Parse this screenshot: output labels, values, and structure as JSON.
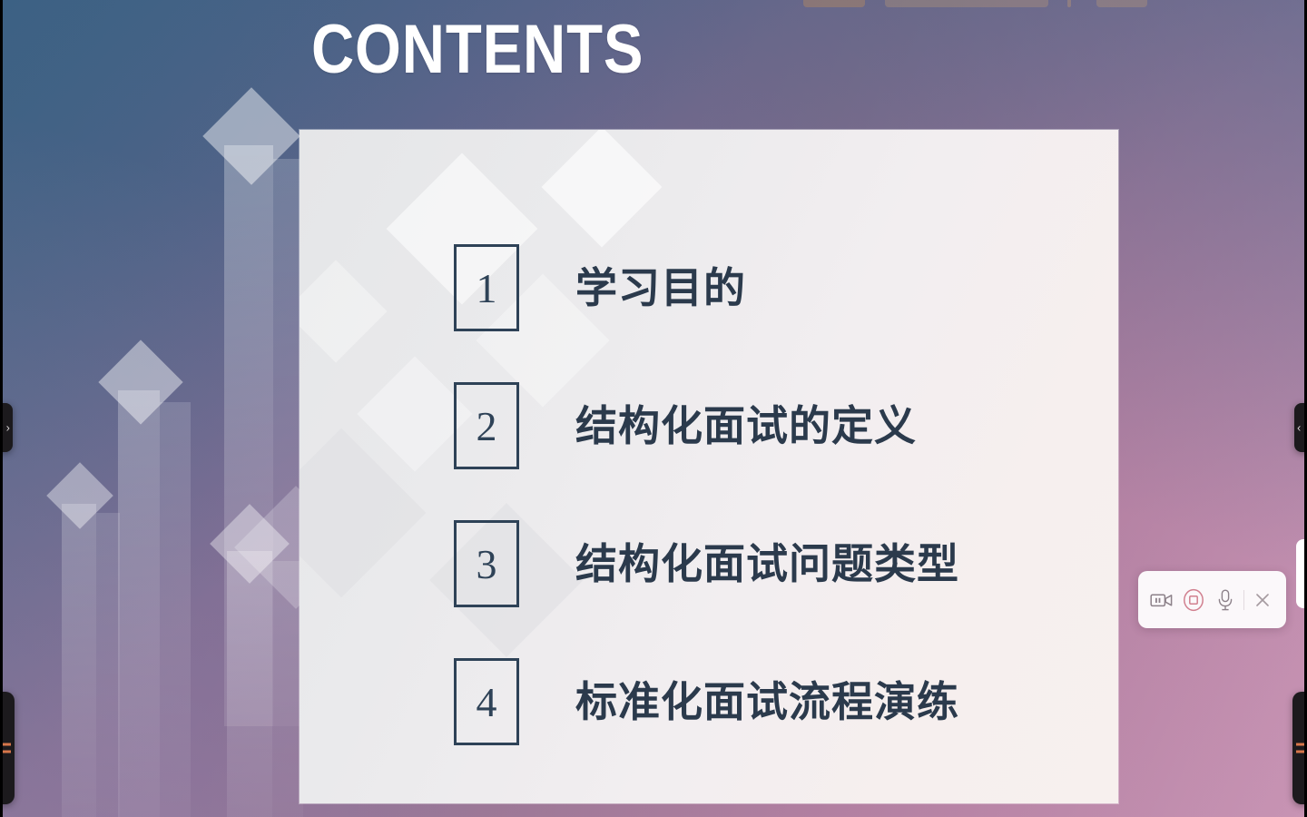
{
  "slide": {
    "title": "CONTENTS",
    "items": [
      {
        "number": "1",
        "label": "学习目的"
      },
      {
        "number": "2",
        "label": "结构化面试的定义"
      },
      {
        "number": "3",
        "label": "结构化面试问题类型"
      },
      {
        "number": "4",
        "label": "标准化面试流程演练"
      }
    ]
  },
  "recorder_toolbar": {
    "camera_button": {
      "icon": "camera-paused-icon",
      "label": ""
    },
    "record_button": {
      "icon": "stop-recording-icon",
      "label": ""
    },
    "mic_button": {
      "icon": "microphone-icon",
      "label": ""
    },
    "close_button": {
      "icon": "close-icon",
      "label": "✕"
    }
  },
  "edge_controls": {
    "left_collapse": {
      "icon": "chevron-right-icon",
      "label": "›"
    },
    "right_collapse": {
      "icon": "chevron-left-icon",
      "label": "‹"
    },
    "left_menu": {
      "icon": "menu-icon"
    },
    "right_menu": {
      "icon": "menu-icon"
    }
  },
  "colors": {
    "bg_start": "#3c6184",
    "bg_mid": "#8e6f8d",
    "bg_end": "#c894b4",
    "card_bg": "#eeeaea",
    "ink": "#2e4257",
    "accent_record": "#d1808f",
    "accent_menu": "#d7764a",
    "title_color": "#ffffff"
  }
}
